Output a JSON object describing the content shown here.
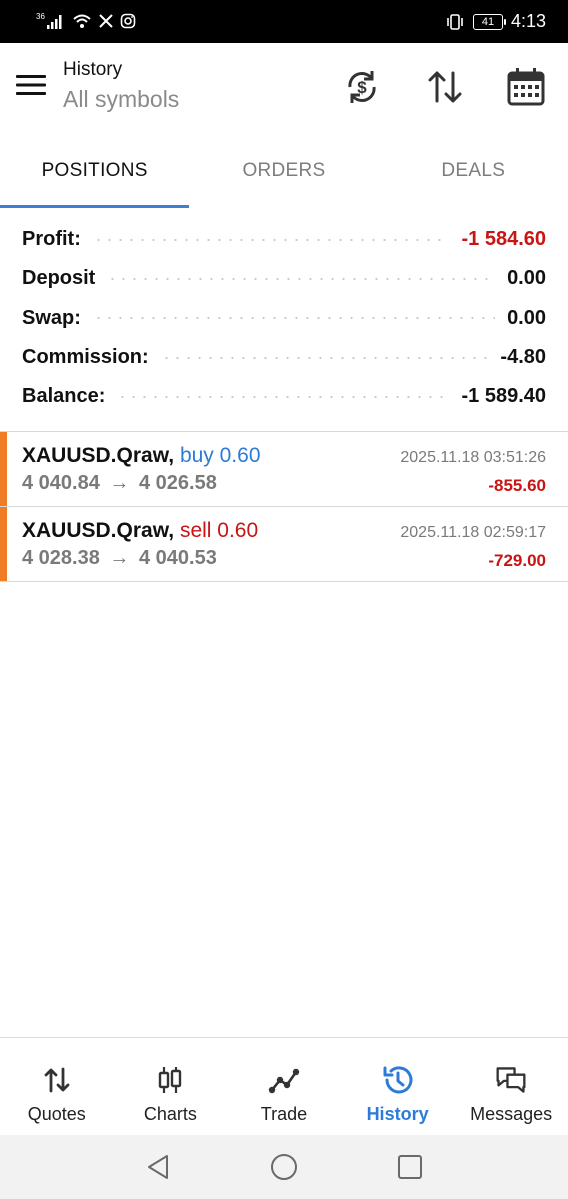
{
  "status_bar": {
    "network": "36",
    "battery": "41",
    "time": "4:13"
  },
  "header": {
    "title": "History",
    "subtitle": "All symbols",
    "icons": [
      "menu-icon",
      "sync-currency-icon",
      "sort-icon",
      "calendar-icon"
    ]
  },
  "tabs": [
    {
      "label": "POSITIONS",
      "active": true
    },
    {
      "label": "ORDERS",
      "active": false
    },
    {
      "label": "DEALS",
      "active": false
    }
  ],
  "summary": [
    {
      "label": "Profit:",
      "value": "-1 584.60",
      "color": "#c81414"
    },
    {
      "label": "Deposit",
      "value": "0.00",
      "color": "#111111"
    },
    {
      "label": "Swap:",
      "value": "0.00",
      "color": "#111111"
    },
    {
      "label": "Commission:",
      "value": "-4.80",
      "color": "#111111"
    },
    {
      "label": "Balance:",
      "value": "-1 589.40",
      "color": "#111111"
    }
  ],
  "positions": [
    {
      "symbol": "XAUUSD.Qraw,",
      "type": "buy 0.60",
      "open_price": "4 040.84",
      "arrow": "→",
      "close_price": "4 026.58",
      "time": "2025.11.18 03:51:26",
      "profit": "-855.60"
    },
    {
      "symbol": "XAUUSD.Qraw,",
      "type": "sell 0.60",
      "open_price": "4 028.38",
      "arrow": "→",
      "close_price": "4 040.53",
      "time": "2025.11.18 02:59:17",
      "profit": "-729.00"
    }
  ],
  "bottom_nav": [
    {
      "label": "Quotes",
      "icon": "quotes-arrows-icon",
      "active": false
    },
    {
      "label": "Charts",
      "icon": "candlestick-icon",
      "active": false
    },
    {
      "label": "Trade",
      "icon": "trade-line-icon",
      "active": false
    },
    {
      "label": "History",
      "icon": "history-clock-icon",
      "active": true
    },
    {
      "label": "Messages",
      "icon": "messages-bubble-icon",
      "active": false
    }
  ],
  "colors": {
    "accent": "#3d7fd6",
    "buy": "#2c7bd8",
    "sell": "#c81414",
    "loss": "#c81414",
    "marker": "#f07c25"
  }
}
